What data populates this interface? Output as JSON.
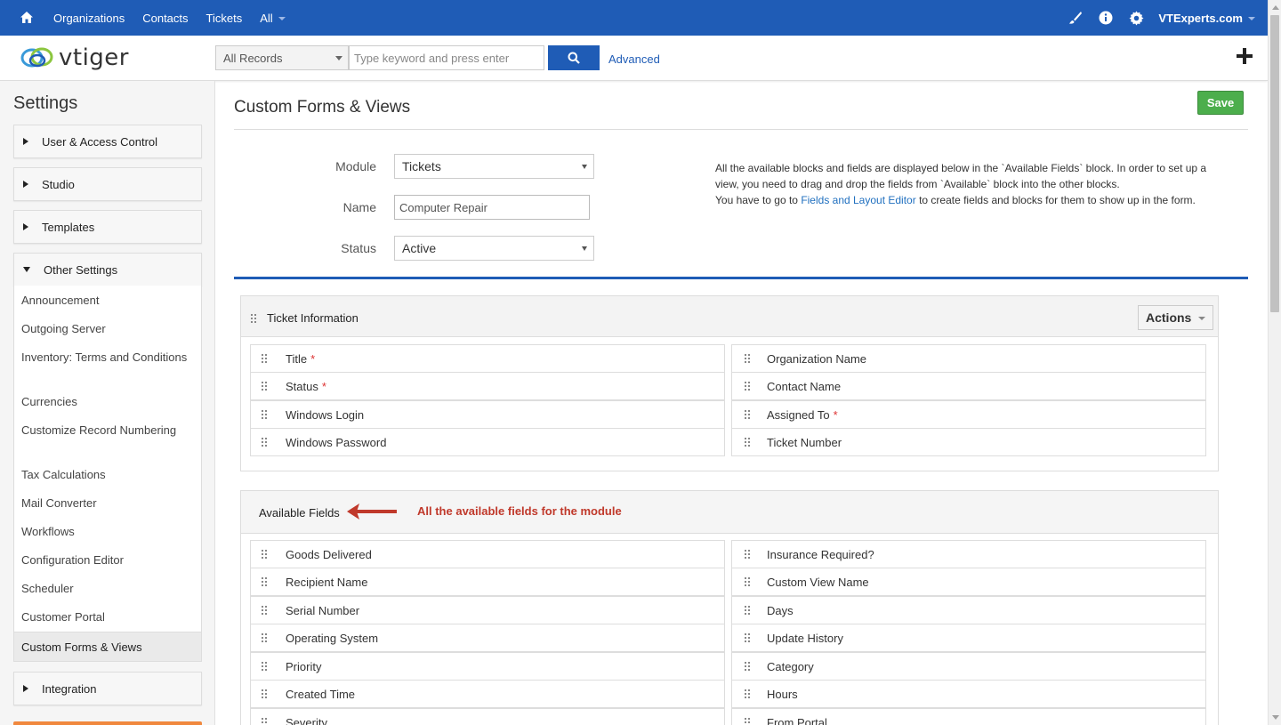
{
  "topnav": {
    "items": [
      "Organizations",
      "Contacts",
      "Tickets",
      "All"
    ],
    "user": "VTExperts.com"
  },
  "header": {
    "logo_text": "vtiger",
    "search_scope": "All Records",
    "search_placeholder": "Type keyword and press enter",
    "advanced_label": "Advanced"
  },
  "sidebar": {
    "title": "Settings",
    "blocks": [
      "User & Access Control",
      "Studio",
      "Templates",
      "Other Settings",
      "Integration"
    ],
    "other_settings_items": [
      "Announcement",
      "Outgoing Server",
      "Inventory: Terms and Conditions",
      "Currencies",
      "Customize Record Numbering",
      "Tax Calculations",
      "Mail Converter",
      "Workflows",
      "Configuration Editor",
      "Scheduler",
      "Customer Portal"
    ],
    "active_item": "Custom Forms & Views"
  },
  "main": {
    "title": "Custom Forms & Views",
    "save_label": "Save",
    "form": {
      "module_label": "Module",
      "module_value": "Tickets",
      "name_label": "Name",
      "name_value": "Computer Repair",
      "status_label": "Status",
      "status_value": "Active"
    },
    "info": {
      "text1": "All the available blocks and fields are displayed below in the `Available Fields` block. In order to set up a view, you need to drag and drop the fields from `Available` block into the other blocks.",
      "text2_pre": "You have to go to ",
      "text2_link": "Fields and Layout Editor",
      "text2_post": " to create fields and blocks for them to show up in the form."
    },
    "ticket_block": {
      "title": "Ticket Information",
      "actions_label": "Actions",
      "left_fields": [
        {
          "label": "Title",
          "required": "*"
        },
        {
          "label": "Status",
          "required": "*"
        },
        {
          "label": "Windows Login",
          "required": ""
        },
        {
          "label": "Windows Password",
          "required": ""
        }
      ],
      "right_fields": [
        {
          "label": "Organization Name",
          "required": ""
        },
        {
          "label": "Contact Name",
          "required": ""
        },
        {
          "label": "Assigned To",
          "required": "*"
        },
        {
          "label": "Ticket Number",
          "required": ""
        }
      ]
    },
    "available_block": {
      "title": "Available Fields",
      "annotation": "All the available fields for the module",
      "left_fields": [
        "Goods Delivered",
        "Recipient Name",
        "Serial Number",
        "Operating System",
        "Priority",
        "Created Time",
        "Severity"
      ],
      "right_fields": [
        "Insurance Required?",
        "Custom View Name",
        "Days",
        "Update History",
        "Category",
        "Hours",
        "From Portal"
      ]
    }
  },
  "colors": {
    "nav_blue": "#1f5cb6",
    "save_green": "#4cae4c",
    "annotation_red": "#c0392b",
    "required_red": "#d33"
  }
}
